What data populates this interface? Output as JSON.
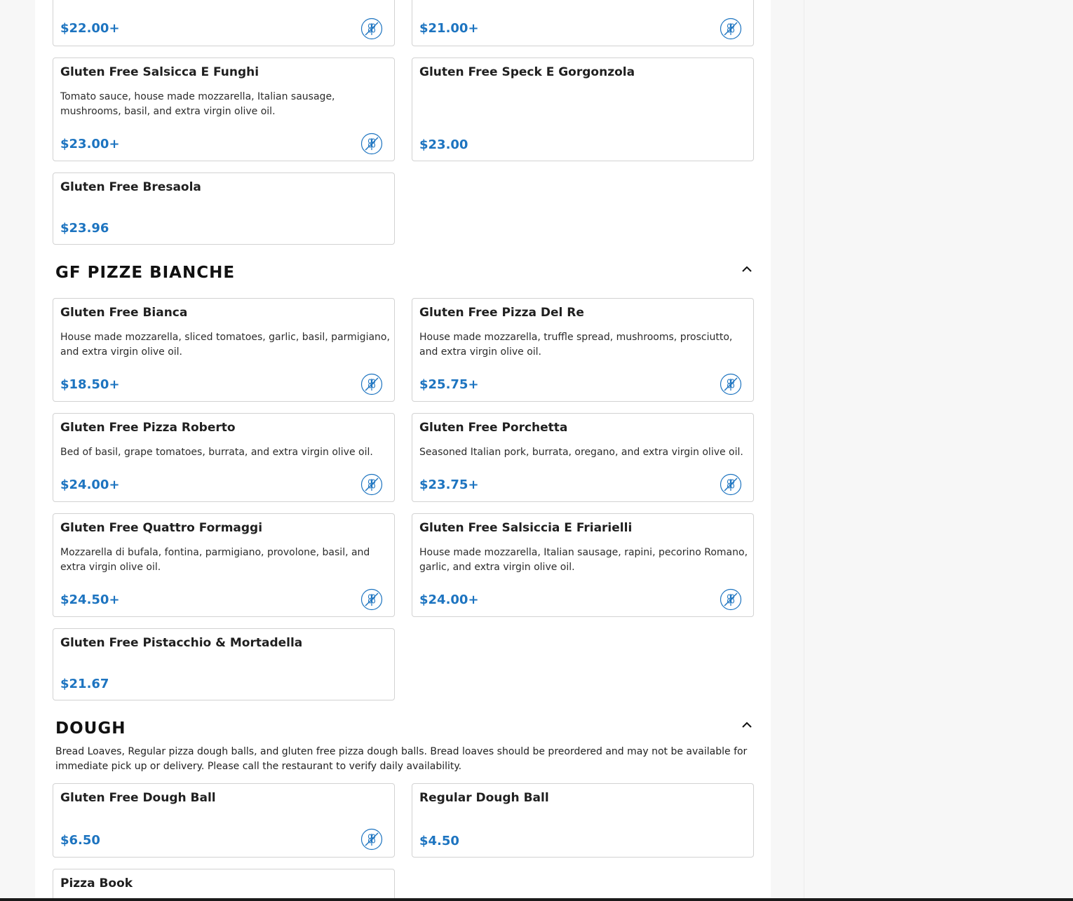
{
  "colors": {
    "price": "#1d74c0",
    "border": "#d2d2d2",
    "accent_icon": "#1d74c0"
  },
  "top_cards": [
    {
      "price": "$22.00+"
    },
    {
      "price": "$21.00+"
    }
  ],
  "section1_items": [
    {
      "name": "Gluten Free Salsicca E Funghi",
      "desc": "Tomato sauce, house made mozzarella, Italian sausage, mushrooms, basil, and extra virgin olive oil.",
      "price": "$23.00+"
    },
    {
      "name": "Gluten Free Speck E Gorgonzola",
      "desc": "",
      "price": "$23.00"
    },
    {
      "name": "Gluten Free Bresaola",
      "desc": "",
      "price": "$23.96"
    }
  ],
  "bianche": {
    "title": "GF PIZZE BIANCHE",
    "items": [
      {
        "name": "Gluten Free Bianca",
        "desc": "House made mozzarella, sliced tomatoes, garlic, basil, parmigiano, and extra virgin olive oil.",
        "price": "$18.50+"
      },
      {
        "name": "Gluten Free Pizza Del Re",
        "desc": "House made mozzarella, truffle spread, mushrooms, prosciutto, and extra virgin olive oil.",
        "price": "$25.75+"
      },
      {
        "name": "Gluten Free Pizza Roberto",
        "desc": "Bed of basil, grape tomatoes, burrata, and extra virgin olive oil.",
        "price": "$24.00+"
      },
      {
        "name": "Gluten Free Porchetta",
        "desc": "Seasoned Italian pork, burrata, oregano, and extra virgin olive oil.",
        "price": "$23.75+"
      },
      {
        "name": "Gluten Free Quattro Formaggi",
        "desc": "Mozzarella di bufala, fontina, parmigiano, provolone, basil, and extra virgin olive oil.",
        "price": "$24.50+"
      },
      {
        "name": "Gluten Free Salsiccia E Friarielli",
        "desc": "House made mozzarella, Italian sausage, rapini, pecorino Romano, garlic, and extra virgin olive oil.",
        "price": "$24.00+"
      },
      {
        "name": "Gluten Free Pistacchio & Mortadella",
        "desc": "",
        "price": "$21.67"
      }
    ]
  },
  "dough": {
    "title": "DOUGH",
    "description": "Bread Loaves, Regular pizza dough balls, and gluten free pizza dough balls. Bread loaves should be preordered and may not be available for immediate pick up or delivery. Please call the restaurant to verify daily availability.",
    "items": [
      {
        "name": "Gluten Free Dough Ball",
        "price": "$6.50"
      },
      {
        "name": "Regular Dough Ball",
        "price": "$4.50"
      },
      {
        "name": "Pizza Book"
      }
    ]
  }
}
